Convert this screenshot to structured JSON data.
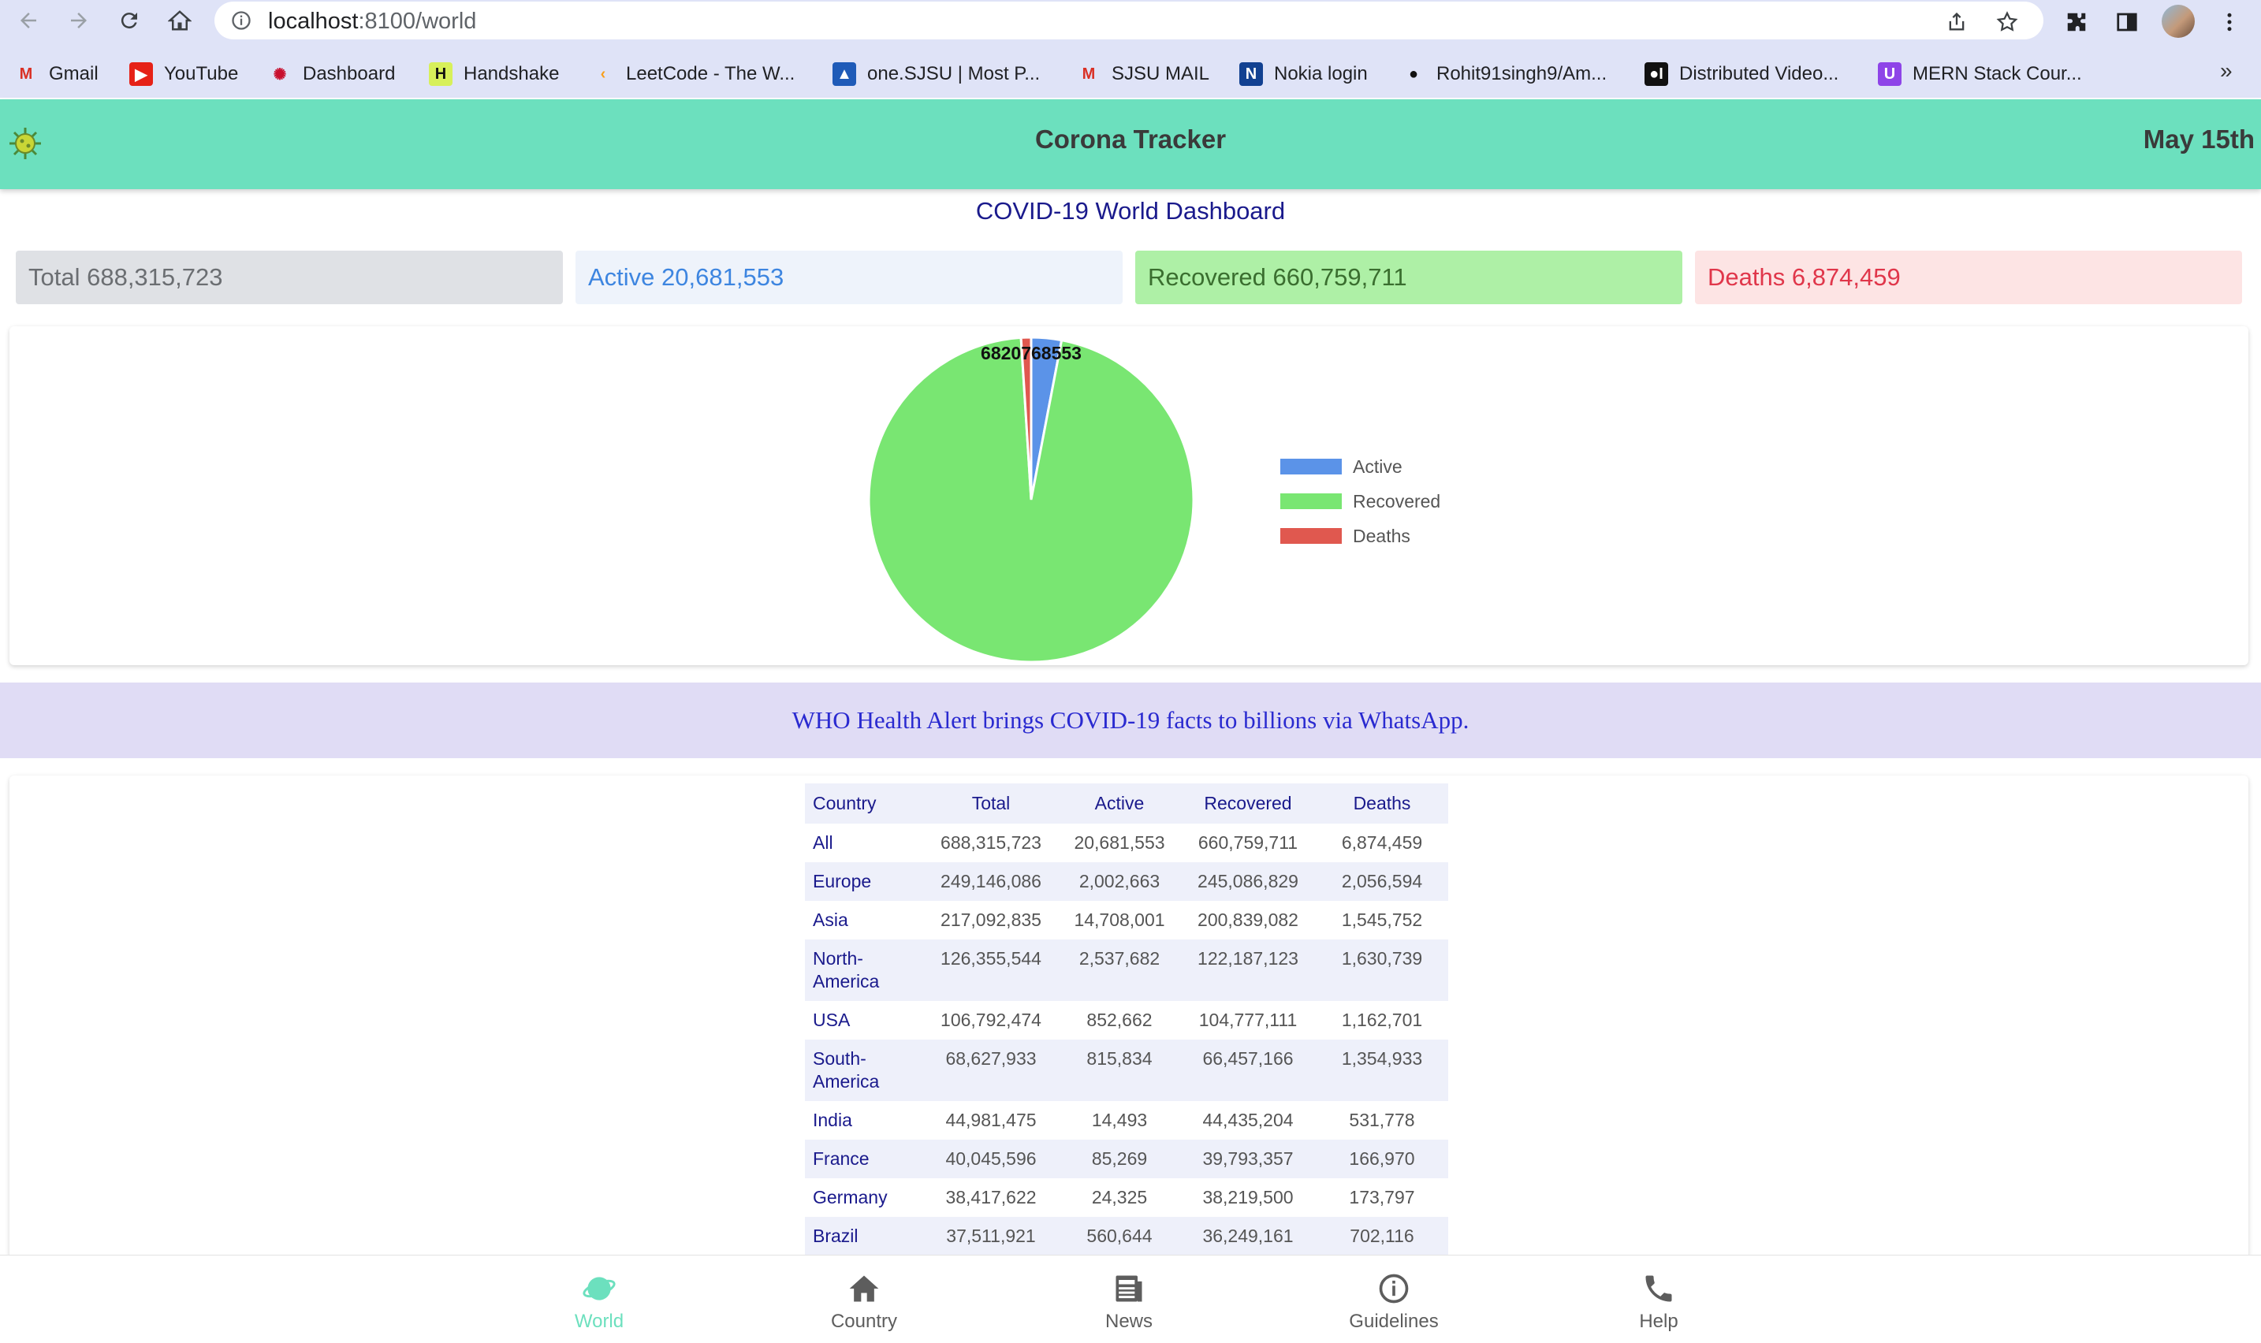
{
  "browser": {
    "url_host": "localhost",
    "url_path": ":8100/world",
    "bookmarks": [
      {
        "label": "Gmail",
        "icon": "gmail-icon",
        "glyph": "M",
        "color": "#d93025",
        "bg": "transparent"
      },
      {
        "label": "YouTube",
        "icon": "youtube-icon",
        "glyph": "▶",
        "color": "#ffffff",
        "bg": "#e62117"
      },
      {
        "label": "Dashboard",
        "icon": "dashboard-icon",
        "glyph": "✺",
        "color": "#c8102e",
        "bg": "transparent"
      },
      {
        "label": "Handshake",
        "icon": "handshake-icon",
        "glyph": "H",
        "color": "#111111",
        "bg": "#d7f05a"
      },
      {
        "label": "LeetCode - The W...",
        "icon": "leetcode-icon",
        "glyph": "‹",
        "color": "#f89f1b",
        "bg": "transparent"
      },
      {
        "label": "one.SJSU | Most P...",
        "icon": "sjsu-icon",
        "glyph": "▲",
        "color": "#ffffff",
        "bg": "#1f5bb8"
      },
      {
        "label": "SJSU MAIL",
        "icon": "gmail-icon",
        "glyph": "M",
        "color": "#d93025",
        "bg": "transparent"
      },
      {
        "label": "Nokia login",
        "icon": "nokia-icon",
        "glyph": "N",
        "color": "#ffffff",
        "bg": "#124191"
      },
      {
        "label": "Rohit91singh9/Am...",
        "icon": "github-icon",
        "glyph": "●",
        "color": "#111111",
        "bg": "transparent"
      },
      {
        "label": "Distributed Video...",
        "icon": "medium-icon",
        "glyph": "●I",
        "color": "#ffffff",
        "bg": "#111111"
      },
      {
        "label": "MERN Stack Cour...",
        "icon": "udemy-icon",
        "glyph": "U",
        "color": "#ffffff",
        "bg": "#8e44e8"
      }
    ],
    "more_label": "»"
  },
  "header": {
    "title": "Corona Tracker",
    "date": "May 15th"
  },
  "dashboard": {
    "title": "COVID-19 World Dashboard",
    "stats": {
      "total": "Total 688,315,723",
      "active": "Active 20,681,553",
      "recovered": "Recovered 660,759,711",
      "deaths": "Deaths 6,874,459"
    }
  },
  "chart_data": {
    "type": "pie",
    "categories": [
      "Active",
      "Recovered",
      "Deaths"
    ],
    "values": [
      20681553,
      660759711,
      6874459
    ],
    "colors": [
      "#5b93e8",
      "#79e672",
      "#e0584f"
    ],
    "legend": "right",
    "data_labels_overlapped": "6820768553"
  },
  "alert": {
    "text": "WHO Health Alert brings COVID-19 facts to billions via WhatsApp."
  },
  "table": {
    "headers": [
      "Country",
      "Total",
      "Active",
      "Recovered",
      "Deaths"
    ],
    "rows": [
      {
        "country": "All",
        "total": "688,315,723",
        "active": "20,681,553",
        "recovered": "660,759,711",
        "deaths": "6,874,459"
      },
      {
        "country": "Europe",
        "total": "249,146,086",
        "active": "2,002,663",
        "recovered": "245,086,829",
        "deaths": "2,056,594"
      },
      {
        "country": "Asia",
        "total": "217,092,835",
        "active": "14,708,001",
        "recovered": "200,839,082",
        "deaths": "1,545,752"
      },
      {
        "country": "North-America",
        "total": "126,355,544",
        "active": "2,537,682",
        "recovered": "122,187,123",
        "deaths": "1,630,739"
      },
      {
        "country": "USA",
        "total": "106,792,474",
        "active": "852,662",
        "recovered": "104,777,111",
        "deaths": "1,162,701"
      },
      {
        "country": "South-America",
        "total": "68,627,933",
        "active": "815,834",
        "recovered": "66,457,166",
        "deaths": "1,354,933"
      },
      {
        "country": "India",
        "total": "44,981,475",
        "active": "14,493",
        "recovered": "44,435,204",
        "deaths": "531,778"
      },
      {
        "country": "France",
        "total": "40,045,596",
        "active": "85,269",
        "recovered": "39,793,357",
        "deaths": "166,970"
      },
      {
        "country": "Germany",
        "total": "38,417,622",
        "active": "24,325",
        "recovered": "38,219,500",
        "deaths": "173,797"
      },
      {
        "country": "Brazil",
        "total": "37,511,921",
        "active": "560,644",
        "recovered": "36,249,161",
        "deaths": "702,116"
      }
    ]
  },
  "tabs": [
    {
      "label": "World",
      "icon": "globe-icon",
      "active": true
    },
    {
      "label": "Country",
      "icon": "home-icon",
      "active": false
    },
    {
      "label": "News",
      "icon": "newspaper-icon",
      "active": false
    },
    {
      "label": "Guidelines",
      "icon": "info-icon",
      "active": false
    },
    {
      "label": "Help",
      "icon": "phone-icon",
      "active": false
    }
  ],
  "colors": {
    "header_bg": "#6ce0be",
    "accent": "#6ce0be",
    "title_blue": "#1a1a8c"
  }
}
